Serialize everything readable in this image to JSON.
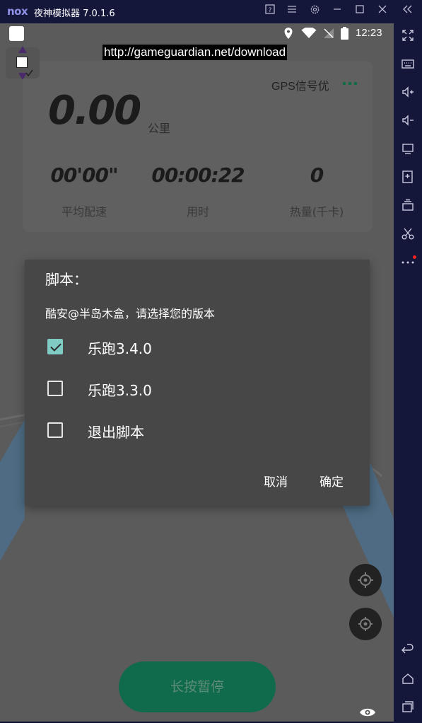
{
  "window": {
    "logo": "nox",
    "title": "夜神模拟器 7.0.1.6",
    "controls": [
      "help-icon",
      "menu-icon",
      "settings-icon",
      "minimize-icon",
      "maximize-icon",
      "close-icon",
      "collapse-sidebar-icon"
    ]
  },
  "sidebar": {
    "buttons": [
      "fullscreen-icon",
      "keyboard-icon",
      "volume-up-icon",
      "volume-down-icon",
      "screen-icon",
      "apk-install-icon",
      "multi-instance-icon",
      "scissors-icon",
      "more-icon",
      "back-icon",
      "home-icon",
      "recents-icon"
    ]
  },
  "statusbar": {
    "time": "12:23"
  },
  "overlay": {
    "url": "http://gameguardian.net/download"
  },
  "stats": {
    "distance": "0.00",
    "distance_unit": "公里",
    "gps": "GPS信号优",
    "pace": "00'00\"",
    "pace_label": "平均配速",
    "duration": "00:00:22",
    "duration_label": "用时",
    "calories": "0",
    "calories_label": "热量(千卡)"
  },
  "dialog": {
    "title": "脚本：",
    "message": "酷安@半岛木盒，请选择您的版本",
    "options": [
      {
        "label": "乐跑3.4.0",
        "checked": true
      },
      {
        "label": "乐跑3.3.0",
        "checked": false
      },
      {
        "label": "退出脚本",
        "checked": false
      }
    ],
    "cancel": "取消",
    "confirm": "确定"
  },
  "bottom": {
    "long_press": "长按暂停"
  },
  "colors": {
    "accent_check": "#80cbc4",
    "pause_button": "#0f6b4b",
    "emulator_frame": "#14163a"
  }
}
